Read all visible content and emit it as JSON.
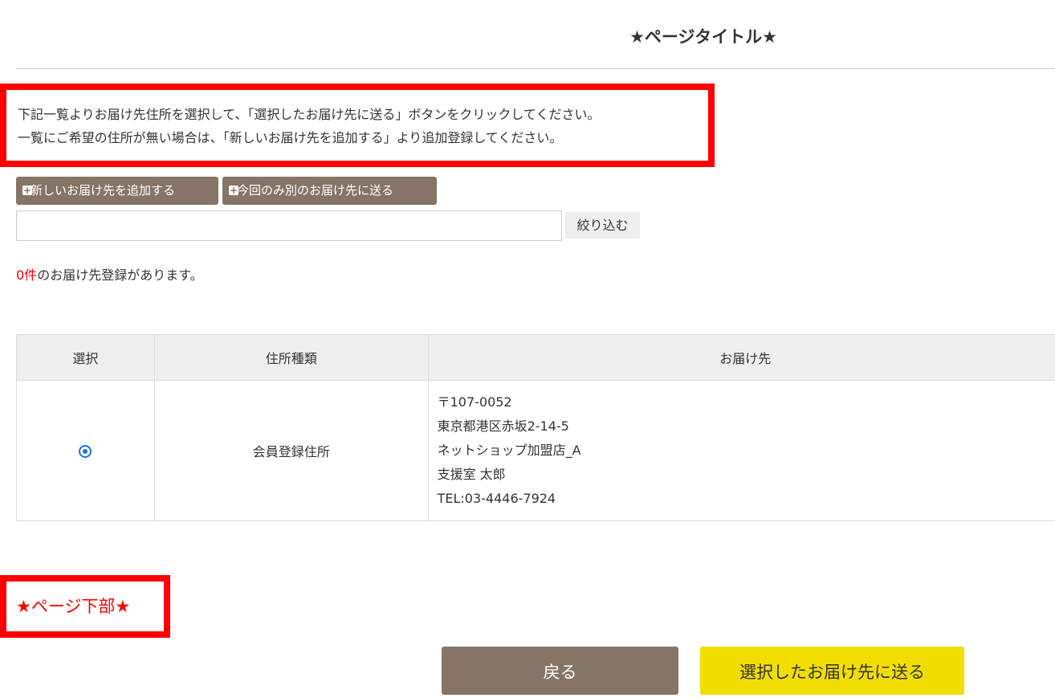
{
  "page_title": "★ページタイトル★",
  "intro": {
    "line1": "下記一覧よりお届け先住所を選択して、「選択したお届け先に送る」ボタンをクリックしてください。",
    "line2": "一覧にご希望の住所が無い場合は、「新しいお届け先を追加する」より追加登録してください。"
  },
  "buttons": {
    "add_new": "新しいお届け先を追加する",
    "send_once": "今回のみ別のお届け先に送る",
    "filter": "絞り込む",
    "back": "戻る",
    "send_selected": "選択したお届け先に送る"
  },
  "filter_input": {
    "value": "",
    "placeholder": ""
  },
  "count": {
    "number": "0件",
    "suffix": "のお届け先登録があります。"
  },
  "table": {
    "headers": [
      "選択",
      "住所種類",
      "お届け先"
    ],
    "rows": [
      {
        "selected": true,
        "type": "会員登録住所",
        "address": [
          "〒107-0052",
          "東京都港区赤坂2-14-5",
          "ネットショップ加盟店_A",
          "支援室 太郎",
          "TEL:03-4446-7924"
        ]
      }
    ]
  },
  "bottom_note": "★ページ下部★",
  "colors": {
    "brown_button": "#857566",
    "yellow_button": "#f2dd00",
    "highlight_red": "#ff0000",
    "radio_blue": "#1a73e8"
  },
  "icons": {
    "add_buttons": "plus-square-icon"
  }
}
